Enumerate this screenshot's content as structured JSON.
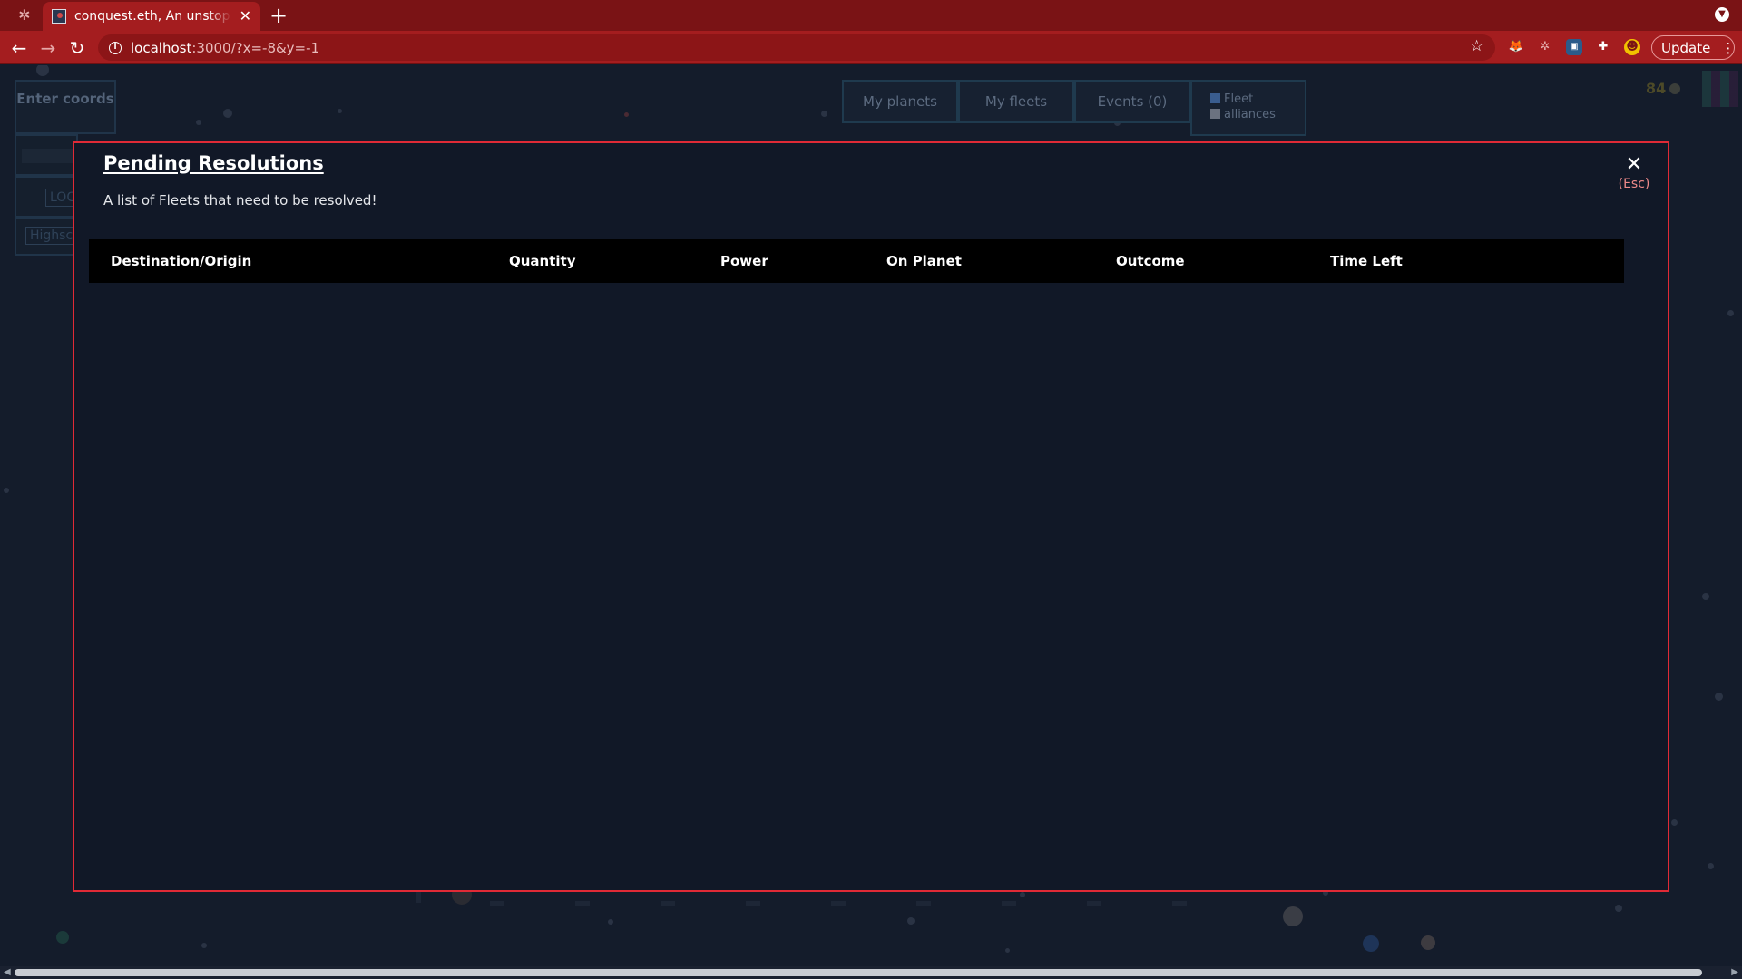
{
  "browser": {
    "tab_title": "conquest.eth, An unstoppable",
    "url_host": "localhost",
    "url_path": ":3000/?x=-8&y=-1",
    "update_label": "Update"
  },
  "hud": {
    "enter_coords": "Enter coords",
    "panel_locate": "LOC",
    "panel_highscores": "Highsc",
    "tabs": [
      "My planets",
      "My fleets",
      "Events (0)"
    ],
    "toggle_fleet": "Fleet",
    "toggle_alliances": "alliances",
    "score": "84"
  },
  "modal": {
    "title": "Pending Resolutions",
    "close_label": "(Esc)",
    "subtitle": "A list of Fleets that need to be resolved!",
    "columns": [
      "Destination/Origin",
      "Quantity",
      "Power",
      "On Planet",
      "Outcome",
      "Time Left"
    ]
  },
  "colors": {
    "browser_frame": "#a41d1f",
    "modal_border": "#e02a36",
    "modal_bg": "#111827"
  }
}
